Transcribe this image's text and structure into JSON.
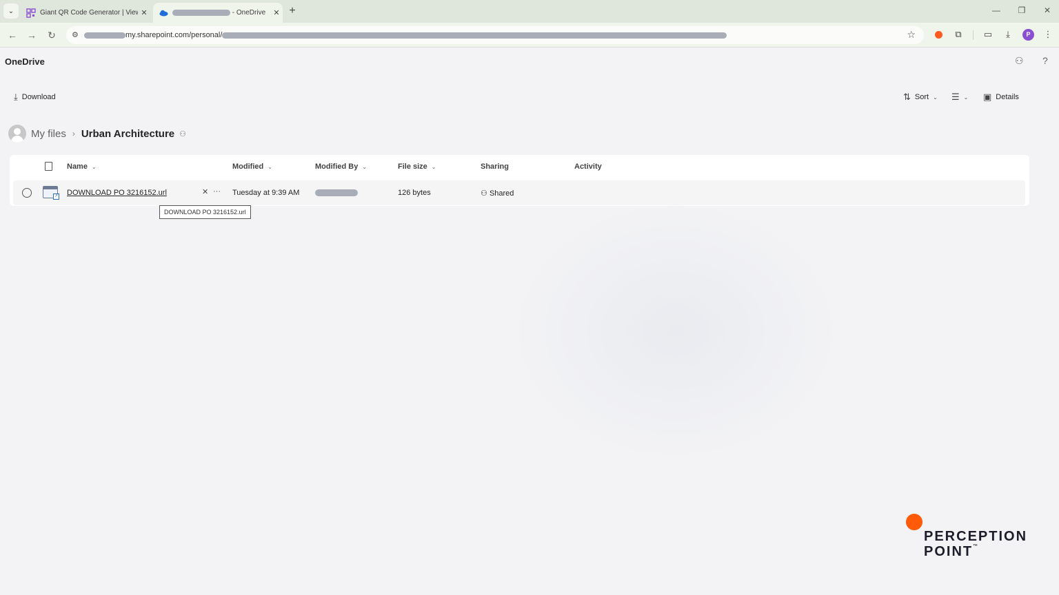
{
  "browser": {
    "tabs": [
      {
        "title": "Giant QR Code Generator | View",
        "active": false
      },
      {
        "title_suffix": "- OneDrive",
        "active": true
      }
    ],
    "address": {
      "url_visible": "my.sharepoint.com/personal/"
    },
    "profile_initial": "P",
    "extension_color": "#ff5a1f"
  },
  "app": {
    "name": "OneDrive",
    "header_icons": [
      "people-settings-icon",
      "help-icon"
    ]
  },
  "commandbar": {
    "download_label": "Download",
    "sort_label": "Sort",
    "details_label": "Details"
  },
  "breadcrumb": {
    "root": "My files",
    "current": "Urban Architecture"
  },
  "list": {
    "columns": {
      "name": "Name",
      "modified": "Modified",
      "modified_by": "Modified By",
      "file_size": "File size",
      "sharing": "Sharing",
      "activity": "Activity"
    },
    "rows": [
      {
        "name": "DOWNLOAD PO 3216152.url",
        "modified": "Tuesday at 9:39 AM",
        "file_size": "126 bytes",
        "sharing": "Shared"
      }
    ],
    "tooltip": "DOWNLOAD PO 3216152.url"
  },
  "watermark": {
    "line1": "PERCEPTION",
    "line2": "POINT",
    "tm": "™",
    "accent": "#ff5a0a"
  }
}
